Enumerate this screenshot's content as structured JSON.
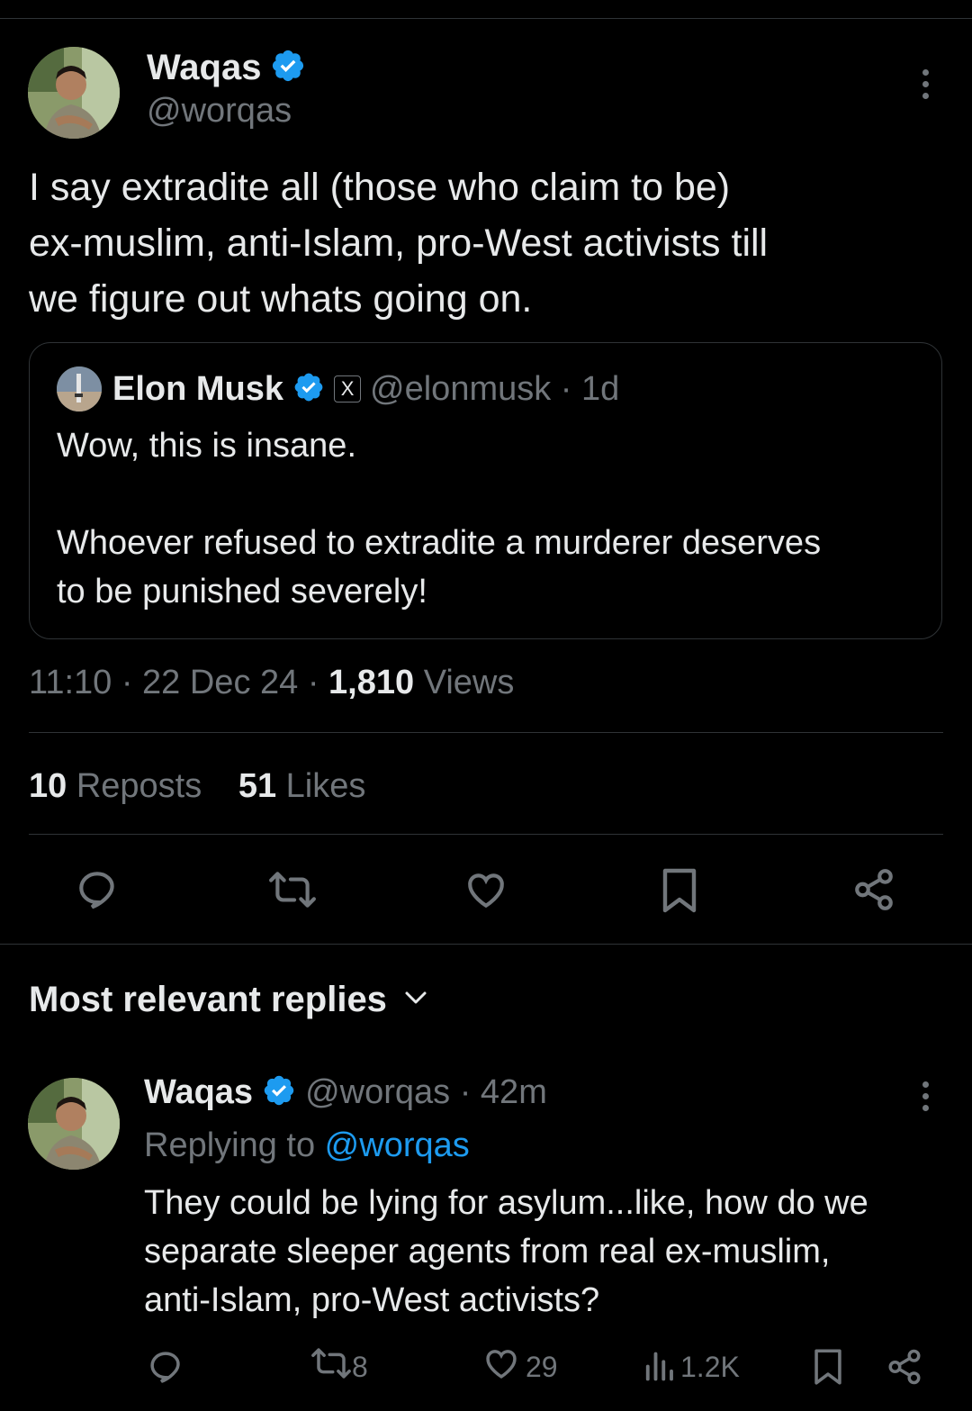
{
  "tweet": {
    "author_name": "Waqas",
    "author_handle": "@worqas",
    "text_line1": "I say extradite all (those who claim to be)",
    "text_line2": "ex-muslim, anti-Islam, pro-West activists till",
    "text_line3": "we figure out whats going on.",
    "quote": {
      "author_name": "Elon Musk",
      "badge": "X",
      "handle_time": "@elonmusk · 1d",
      "line1": "Wow, this is insane.",
      "line2": "Whoever refused to extradite a murderer deserves",
      "line3": "to be punished severely!"
    },
    "time": "11:10 · 22 Dec 24 · ",
    "views_count": "1,810",
    "views_label": " Views",
    "reposts_count": "10",
    "reposts_label": " Reposts",
    "likes_count": "51",
    "likes_label": " Likes"
  },
  "replies_header": "Most relevant replies",
  "reply": {
    "author_name": "Waqas",
    "handle_time": "@worqas · 42m",
    "replying_prefix": "Replying to ",
    "replying_handle": "@worqas",
    "line1": "They could be lying for asylum...like, how do we",
    "line2": "separate sleeper agents from real ex-muslim,",
    "line3": "anti-Islam, pro-West activists?",
    "reposts": "8",
    "likes": "29",
    "views": "1.2K"
  },
  "icons": {
    "reply": "reply-icon",
    "repost": "repost-icon",
    "like": "heart-icon",
    "bookmark": "bookmark-icon",
    "share": "share-icon",
    "views": "views-icon",
    "verified": "verified-badge-icon",
    "more": "more-icon",
    "chevron": "chevron-down-icon"
  },
  "colors": {
    "background": "#000000",
    "text": "#e7e9ea",
    "muted": "#71767b",
    "accent": "#1d9bf0",
    "border": "#2f3336"
  }
}
